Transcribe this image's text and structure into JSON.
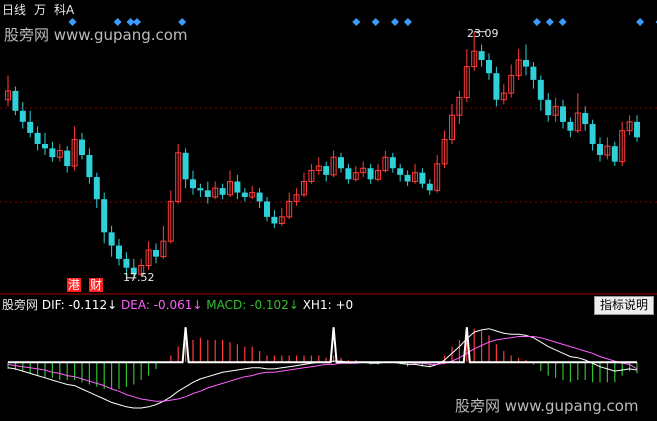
{
  "topbar": {
    "period": "日线",
    "ten_thousand": "万",
    "sci": "科A"
  },
  "watermark": {
    "top": "股旁网 www.gupang.com",
    "bottom": "股旁网 www.gupang.com"
  },
  "price_labels": {
    "high": "23.09",
    "low": "17.52"
  },
  "badges": {
    "gang": "港",
    "cai": "财"
  },
  "macd_bar": {
    "brand": "股旁网",
    "dif": "DIF: -0.112",
    "dea": "DEA: -0.061",
    "macd": "MACD: -0.102",
    "xh1": "XH1: +0",
    "arrow": "↓"
  },
  "indicator_button": "指标说明",
  "colors": {
    "up": "#ff3c3c",
    "down": "#2fd0d8",
    "grid": "#8b0000",
    "dif": "#ffffff",
    "dea": "#ff60ff",
    "macd_pos": "#ff3c3c",
    "macd_neg": "#30c030",
    "xh1": "#ffffff",
    "diamond": "#3a9cff"
  },
  "chart_data": [
    {
      "type": "candlestick",
      "title": "",
      "ylim": [
        17.2,
        23.4
      ],
      "high_marker": 23.09,
      "low_marker": 17.52,
      "candles": [
        [
          21.55,
          21.75,
          22.1,
          21.4
        ],
        [
          21.75,
          21.3,
          21.85,
          21.2
        ],
        [
          21.3,
          21.05,
          21.5,
          20.9
        ],
        [
          21.05,
          20.8,
          21.3,
          20.7
        ],
        [
          20.8,
          20.55,
          20.95,
          20.4
        ],
        [
          20.55,
          20.45,
          20.8,
          20.3
        ],
        [
          20.45,
          20.25,
          20.6,
          20.15
        ],
        [
          20.25,
          20.4,
          20.55,
          20.15
        ],
        [
          20.4,
          20.05,
          20.5,
          19.9
        ],
        [
          20.05,
          20.65,
          20.95,
          19.95
        ],
        [
          20.65,
          20.3,
          20.8,
          20.2
        ],
        [
          20.3,
          19.8,
          20.45,
          19.65
        ],
        [
          19.8,
          19.3,
          19.9,
          19.1
        ],
        [
          19.3,
          18.55,
          19.45,
          18.3
        ],
        [
          18.55,
          18.25,
          18.7,
          18.0
        ],
        [
          18.25,
          17.95,
          18.4,
          17.8
        ],
        [
          17.95,
          17.75,
          18.1,
          17.52
        ],
        [
          17.75,
          17.6,
          17.95,
          17.55
        ],
        [
          17.6,
          17.8,
          17.95,
          17.55
        ],
        [
          17.8,
          18.15,
          18.35,
          17.7
        ],
        [
          18.15,
          18.0,
          18.3,
          17.85
        ],
        [
          18.0,
          18.35,
          18.7,
          17.95
        ],
        [
          18.35,
          19.25,
          19.5,
          18.3
        ],
        [
          19.25,
          20.35,
          20.55,
          19.2
        ],
        [
          20.35,
          19.75,
          20.45,
          19.55
        ],
        [
          19.75,
          19.55,
          19.95,
          19.4
        ],
        [
          19.55,
          19.5,
          19.65,
          19.35
        ],
        [
          19.5,
          19.35,
          19.7,
          19.2
        ],
        [
          19.35,
          19.55,
          19.7,
          19.3
        ],
        [
          19.55,
          19.4,
          19.65,
          19.3
        ],
        [
          19.4,
          19.7,
          19.95,
          19.35
        ],
        [
          19.7,
          19.45,
          19.85,
          19.3
        ],
        [
          19.45,
          19.35,
          19.55,
          19.25
        ],
        [
          19.35,
          19.45,
          19.6,
          19.3
        ],
        [
          19.45,
          19.25,
          19.55,
          19.1
        ],
        [
          19.25,
          18.9,
          19.35,
          18.8
        ],
        [
          18.9,
          18.75,
          19.05,
          18.65
        ],
        [
          18.75,
          18.9,
          19.1,
          18.7
        ],
        [
          18.9,
          19.25,
          19.45,
          18.85
        ],
        [
          19.25,
          19.4,
          19.55,
          19.15
        ],
        [
          19.4,
          19.7,
          19.9,
          19.35
        ],
        [
          19.7,
          19.95,
          20.1,
          19.65
        ],
        [
          19.95,
          20.05,
          20.25,
          19.85
        ],
        [
          20.05,
          19.85,
          20.15,
          19.7
        ],
        [
          19.85,
          20.25,
          20.4,
          19.8
        ],
        [
          20.25,
          20.0,
          20.35,
          19.9
        ],
        [
          20.0,
          19.75,
          20.1,
          19.65
        ],
        [
          19.75,
          19.9,
          20.05,
          19.7
        ],
        [
          19.9,
          20.0,
          20.15,
          19.8
        ],
        [
          20.0,
          19.75,
          20.1,
          19.65
        ],
        [
          19.75,
          19.95,
          20.1,
          19.7
        ],
        [
          19.95,
          20.25,
          20.4,
          19.9
        ],
        [
          20.25,
          20.0,
          20.35,
          19.9
        ],
        [
          20.0,
          19.85,
          20.1,
          19.7
        ],
        [
          19.85,
          19.7,
          19.95,
          19.6
        ],
        [
          19.7,
          19.9,
          20.1,
          19.65
        ],
        [
          19.9,
          19.65,
          20.0,
          19.55
        ],
        [
          19.65,
          19.5,
          19.75,
          19.4
        ],
        [
          19.5,
          20.1,
          20.3,
          19.45
        ],
        [
          20.1,
          20.65,
          20.85,
          20.0
        ],
        [
          20.65,
          21.2,
          21.45,
          20.55
        ],
        [
          21.2,
          21.6,
          21.75,
          21.0
        ],
        [
          21.6,
          22.3,
          22.7,
          21.5
        ],
        [
          22.3,
          22.65,
          23.09,
          22.2
        ],
        [
          22.65,
          22.45,
          22.8,
          22.3
        ],
        [
          22.45,
          22.15,
          22.6,
          22.0
        ],
        [
          22.15,
          21.55,
          22.3,
          21.4
        ],
        [
          21.55,
          21.7,
          21.9,
          21.45
        ],
        [
          21.7,
          22.1,
          22.35,
          21.6
        ],
        [
          22.1,
          22.45,
          22.7,
          22.0
        ],
        [
          22.45,
          22.3,
          22.8,
          22.1
        ],
        [
          22.3,
          22.0,
          22.4,
          21.8
        ],
        [
          22.0,
          21.55,
          22.1,
          21.3
        ],
        [
          21.55,
          21.2,
          21.7,
          21.05
        ],
        [
          21.2,
          21.4,
          21.6,
          21.05
        ],
        [
          21.4,
          21.05,
          21.55,
          20.9
        ],
        [
          21.05,
          20.85,
          21.15,
          20.7
        ],
        [
          20.85,
          21.25,
          21.7,
          20.8
        ],
        [
          21.25,
          21.0,
          21.4,
          20.85
        ],
        [
          21.0,
          20.55,
          21.1,
          20.4
        ],
        [
          20.55,
          20.3,
          20.7,
          20.15
        ],
        [
          20.3,
          20.5,
          20.7,
          20.2
        ],
        [
          20.5,
          20.15,
          20.6,
          20.05
        ],
        [
          20.15,
          20.85,
          21.05,
          20.05
        ],
        [
          20.85,
          21.05,
          21.2,
          20.75
        ],
        [
          21.05,
          20.7,
          21.2,
          20.6
        ]
      ]
    },
    {
      "type": "macd",
      "title": "",
      "ylim": [
        -0.5,
        0.45
      ],
      "series": [
        {
          "name": "DIF",
          "values": [
            -0.05,
            -0.06,
            -0.08,
            -0.1,
            -0.12,
            -0.14,
            -0.16,
            -0.18,
            -0.2,
            -0.21,
            -0.24,
            -0.27,
            -0.3,
            -0.33,
            -0.36,
            -0.38,
            -0.4,
            -0.41,
            -0.41,
            -0.4,
            -0.38,
            -0.35,
            -0.31,
            -0.26,
            -0.22,
            -0.18,
            -0.15,
            -0.13,
            -0.11,
            -0.09,
            -0.08,
            -0.07,
            -0.06,
            -0.05,
            -0.05,
            -0.06,
            -0.06,
            -0.05,
            -0.04,
            -0.03,
            -0.02,
            -0.01,
            0.0,
            0.0,
            0.01,
            0.01,
            0.0,
            0.0,
            0.0,
            -0.01,
            -0.01,
            0.0,
            0.0,
            -0.01,
            -0.02,
            -0.02,
            -0.03,
            -0.04,
            -0.02,
            0.02,
            0.08,
            0.14,
            0.21,
            0.27,
            0.29,
            0.3,
            0.28,
            0.26,
            0.25,
            0.25,
            0.24,
            0.22,
            0.18,
            0.14,
            0.11,
            0.08,
            0.05,
            0.04,
            0.02,
            -0.01,
            -0.04,
            -0.06,
            -0.08,
            -0.07,
            -0.06,
            -0.07
          ]
        },
        {
          "name": "DEA",
          "values": [
            -0.02,
            -0.03,
            -0.04,
            -0.05,
            -0.06,
            -0.07,
            -0.09,
            -0.1,
            -0.12,
            -0.13,
            -0.15,
            -0.17,
            -0.19,
            -0.21,
            -0.24,
            -0.26,
            -0.29,
            -0.31,
            -0.33,
            -0.34,
            -0.35,
            -0.35,
            -0.34,
            -0.33,
            -0.31,
            -0.28,
            -0.26,
            -0.23,
            -0.21,
            -0.19,
            -0.17,
            -0.15,
            -0.13,
            -0.12,
            -0.1,
            -0.09,
            -0.09,
            -0.08,
            -0.07,
            -0.06,
            -0.05,
            -0.04,
            -0.03,
            -0.02,
            -0.02,
            -0.01,
            -0.01,
            -0.01,
            0.0,
            0.0,
            0.0,
            0.0,
            0.0,
            0.0,
            0.0,
            -0.01,
            -0.01,
            -0.02,
            -0.02,
            -0.01,
            0.01,
            0.04,
            0.08,
            0.12,
            0.15,
            0.18,
            0.2,
            0.21,
            0.22,
            0.23,
            0.23,
            0.23,
            0.22,
            0.2,
            0.18,
            0.16,
            0.14,
            0.12,
            0.1,
            0.08,
            0.05,
            0.03,
            0.01,
            -0.01,
            -0.02,
            -0.06
          ]
        },
        {
          "name": "MACD",
          "values": [
            -0.06,
            -0.07,
            -0.08,
            -0.1,
            -0.12,
            -0.14,
            -0.14,
            -0.16,
            -0.16,
            -0.16,
            -0.18,
            -0.2,
            -0.22,
            -0.24,
            -0.24,
            -0.24,
            -0.22,
            -0.2,
            -0.16,
            -0.12,
            -0.06,
            0.0,
            0.06,
            0.14,
            0.18,
            0.2,
            0.22,
            0.2,
            0.2,
            0.2,
            0.18,
            0.16,
            0.14,
            0.14,
            0.1,
            0.06,
            0.06,
            0.06,
            0.06,
            0.06,
            0.06,
            0.06,
            0.06,
            0.04,
            0.06,
            0.04,
            0.02,
            0.02,
            0.0,
            -0.02,
            -0.02,
            0.0,
            0.0,
            -0.02,
            -0.04,
            -0.02,
            -0.04,
            -0.04,
            0.0,
            0.06,
            0.14,
            0.2,
            0.26,
            0.3,
            0.28,
            0.24,
            0.16,
            0.1,
            0.06,
            0.04,
            0.02,
            -0.02,
            -0.08,
            -0.12,
            -0.14,
            -0.16,
            -0.18,
            -0.16,
            -0.16,
            -0.18,
            -0.18,
            -0.18,
            -0.18,
            -0.12,
            -0.08,
            -0.1
          ]
        },
        {
          "name": "XH1",
          "values": [
            0,
            0,
            0,
            0,
            0,
            0,
            0,
            0,
            0,
            0,
            0,
            0,
            0,
            0,
            0,
            0,
            0,
            0,
            0,
            0,
            0,
            0,
            0,
            0,
            1,
            0,
            0,
            0,
            0,
            0,
            0,
            0,
            0,
            0,
            0,
            0,
            0,
            0,
            0,
            0,
            0,
            0,
            0,
            0,
            1,
            0,
            0,
            0,
            0,
            0,
            0,
            0,
            0,
            0,
            0,
            0,
            0,
            0,
            0,
            0,
            0,
            0,
            1,
            0,
            0,
            0,
            0,
            0,
            0,
            0,
            0,
            0,
            0,
            0,
            0,
            0,
            0,
            0,
            0,
            0,
            0,
            0,
            0,
            0,
            0,
            0
          ]
        }
      ],
      "signal_diamonds": [
        10,
        17,
        19,
        20,
        27,
        54,
        57,
        60,
        62,
        82,
        84,
        86,
        98,
        101
      ]
    }
  ]
}
